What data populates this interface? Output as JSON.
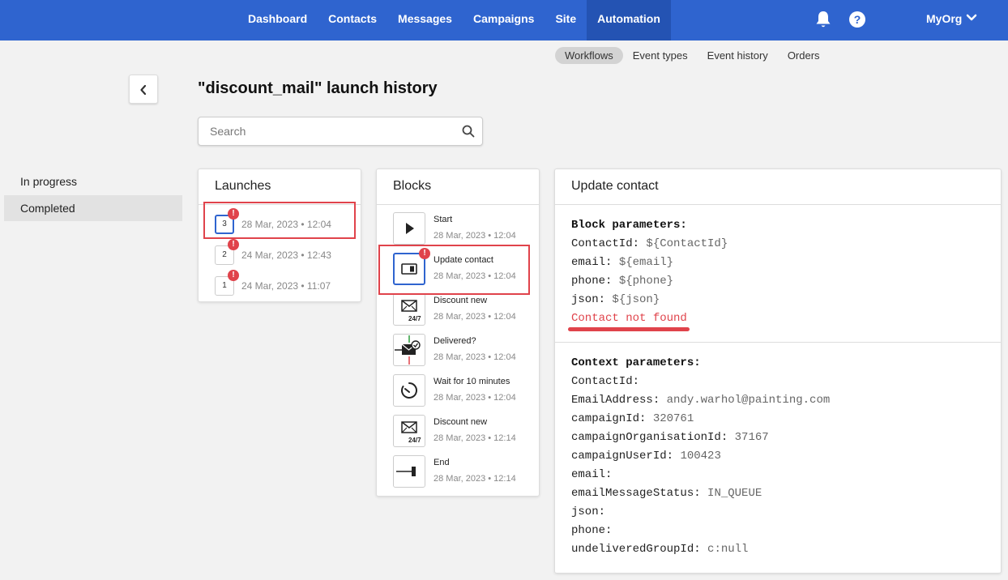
{
  "nav": {
    "items": [
      "Dashboard",
      "Contacts",
      "Messages",
      "Campaigns",
      "Site",
      "Automation"
    ],
    "active_index": 5,
    "org": "MyOrg",
    "help_glyph": "?"
  },
  "subnav": {
    "items": [
      "Workflows",
      "Event types",
      "Event history",
      "Orders"
    ],
    "active_index": 0
  },
  "page": {
    "title": "\"discount_mail\" launch history",
    "search_placeholder": "Search"
  },
  "sidebar": {
    "items": [
      {
        "label": "In progress",
        "active": false
      },
      {
        "label": "Completed",
        "active": true
      }
    ]
  },
  "launches": {
    "title": "Launches",
    "items": [
      {
        "number": "3",
        "date": "28 Mar, 2023 • 12:04",
        "error": "!",
        "selected": true
      },
      {
        "number": "2",
        "date": "24 Mar, 2023 • 12:43",
        "error": "!",
        "selected": false
      },
      {
        "number": "1",
        "date": "24 Mar, 2023 • 11:07",
        "error": "!",
        "selected": false
      }
    ]
  },
  "blocks": {
    "title": "Blocks",
    "items": [
      {
        "icon": "play-icon",
        "name": "Start",
        "date": "28 Mar, 2023 • 12:04"
      },
      {
        "icon": "contact-card-icon",
        "name": "Update contact",
        "date": "28 Mar, 2023 • 12:04",
        "error": "!",
        "selected": true
      },
      {
        "icon": "mail-24-7-icon",
        "name": "Discount new",
        "date": "28 Mar, 2023 • 12:04",
        "badge": "24/7"
      },
      {
        "icon": "mail-delivered-icon",
        "name": "Delivered?",
        "date": "28 Mar, 2023 • 12:04"
      },
      {
        "icon": "timer-icon",
        "name": "Wait for 10 minutes",
        "date": "28 Mar, 2023 • 12:04"
      },
      {
        "icon": "mail-24-7-icon",
        "name": "Discount new",
        "date": "28 Mar, 2023 • 12:14",
        "badge": "24/7"
      },
      {
        "icon": "end-icon",
        "name": "End",
        "date": "28 Mar, 2023 • 12:14"
      }
    ]
  },
  "details": {
    "title": "Update contact",
    "block_params_title": "Block parameters:",
    "block_params": [
      {
        "key": "ContactId:",
        "value": "${ContactId}"
      },
      {
        "key": "email:",
        "value": "${email}"
      },
      {
        "key": "phone:",
        "value": "${phone}"
      },
      {
        "key": "json:",
        "value": "${json}"
      }
    ],
    "error": "Contact not found",
    "context_params_title": "Context parameters:",
    "context_params": [
      {
        "key": "ContactId:",
        "value": ""
      },
      {
        "key": "EmailAddress:",
        "value": "andy.warhol@painting.com"
      },
      {
        "key": "campaignId:",
        "value": "320761"
      },
      {
        "key": "campaignOrganisationId:",
        "value": "37167"
      },
      {
        "key": "campaignUserId:",
        "value": "100423"
      },
      {
        "key": "email:",
        "value": ""
      },
      {
        "key": "emailMessageStatus:",
        "value": "IN_QUEUE"
      },
      {
        "key": "json:",
        "value": ""
      },
      {
        "key": "phone:",
        "value": ""
      },
      {
        "key": "undeliveredGroupId:",
        "value": "c:null"
      }
    ]
  },
  "colors": {
    "brand": "#2f64cf",
    "brand_active": "#2453b3",
    "error": "#e0434b"
  }
}
